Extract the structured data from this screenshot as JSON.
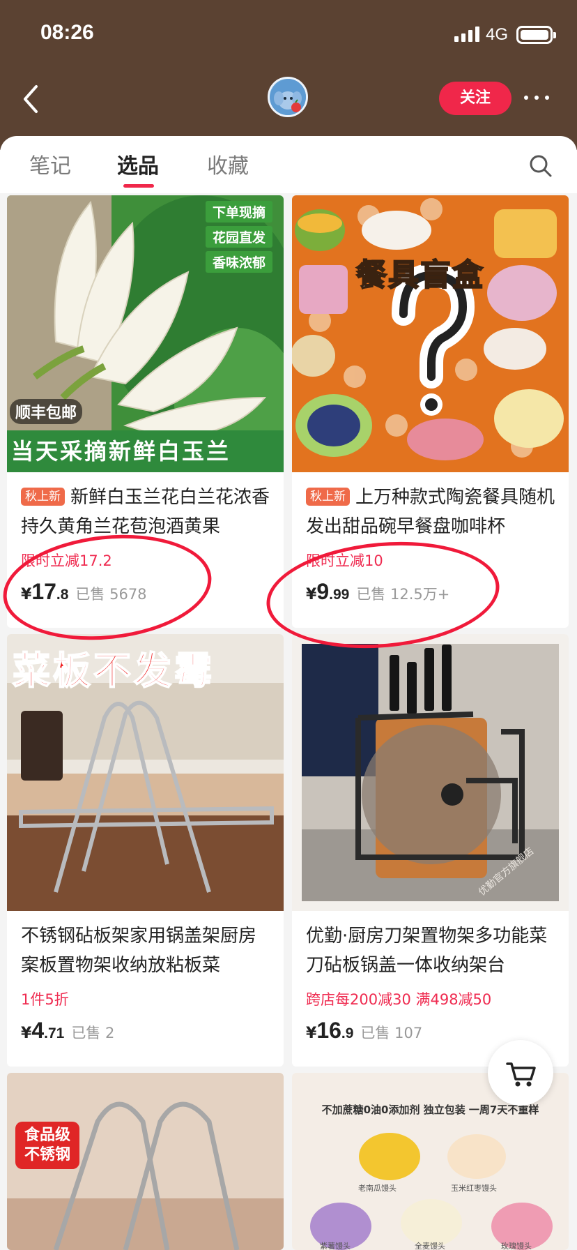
{
  "status": {
    "time": "08:26",
    "network": "4G"
  },
  "header": {
    "follow_label": "关注"
  },
  "tabs": [
    {
      "label": "笔记",
      "active": false
    },
    {
      "label": "选品",
      "active": true
    },
    {
      "label": "收藏",
      "active": false
    }
  ],
  "products": [
    {
      "badge": "秋上新",
      "title": "新鲜白玉兰花白兰花浓香持久黄角兰花苞泡酒黄果",
      "promo": "限时立减17.2",
      "price_int": "17",
      "price_dec": ".8",
      "sold": "已售 5678",
      "image_tags": [
        "下单现摘",
        "花园直发",
        "香味浓郁"
      ],
      "image_badge": "顺丰包邮",
      "image_caption": "当天采摘新鲜白玉兰"
    },
    {
      "badge": "秋上新",
      "title": "上万种款式陶瓷餐具随机发出甜品碗早餐盘咖啡杯",
      "promo": "限时立减10",
      "price_int": "9",
      "price_dec": ".99",
      "sold": "已售 12.5万+",
      "image_caption": "餐具盲盒"
    },
    {
      "title": "不锈钢砧板架家用锅盖架厨房案板置物架收纳放粘板菜",
      "promo": "1件5折",
      "price_int": "4",
      "price_dec": ".71",
      "sold": "已售 2",
      "image_caption": "菜板不发霉"
    },
    {
      "title": "优勤·厨房刀架置物架多功能菜刀砧板锅盖一体收纳架台",
      "promo": "跨店每200减30  满498减50",
      "price_int": "16",
      "price_dec": ".9",
      "sold": "已售 107",
      "image_watermark": "优勤官方旗舰店"
    },
    {
      "image_badge": "食品级不锈钢"
    },
    {
      "image_caption": "不加蔗糖0油0添加剂 独立包装 一周7天不重样",
      "bun_labels": [
        "老南瓜馒头",
        "玉米红枣馒头",
        "紫薯馒头",
        "全麦馒头",
        "玫瑰馒头"
      ]
    }
  ],
  "colors": {
    "header_bg": "#5b4232",
    "accent": "#f0274a",
    "promo": "#ef2b50"
  }
}
